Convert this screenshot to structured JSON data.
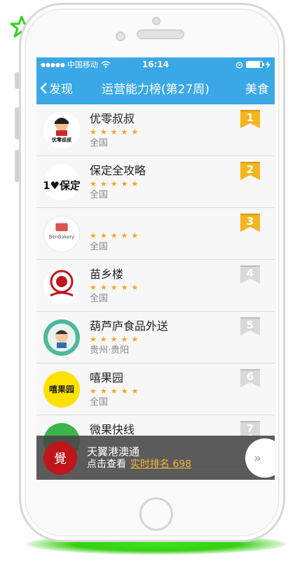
{
  "status": {
    "signal": "●●●●●",
    "carrier": "中国移动",
    "wifi_icon": "wifi-icon",
    "time": "16:14"
  },
  "nav": {
    "back_label": "发现",
    "title": "运营能力榜(第27周)",
    "right_label": "美食"
  },
  "colors": {
    "brand": "#3aa8e6",
    "gold_badge": "#f5b51f",
    "grey_badge": "#d9d9d9",
    "star": "#f5a623"
  },
  "list": [
    {
      "rank": "1",
      "name": "优零叔叔",
      "stars": "★★★★★",
      "region": "全国",
      "logo_text": "优零叔叔",
      "badge": "gold"
    },
    {
      "rank": "2",
      "name": "保定全攻略",
      "stars": "★★★★★",
      "region": "全国",
      "logo_text": "1♥保定",
      "badge": "gold"
    },
    {
      "rank": "3",
      "name": "",
      "stars": "★★★★★",
      "region": "全国",
      "logo_text": "BenBakery",
      "badge": "gold"
    },
    {
      "rank": "4",
      "name": "苗乡楼",
      "stars": "★★★★★",
      "region": "全国",
      "logo_text": "",
      "badge": "grey"
    },
    {
      "rank": "5",
      "name": "葫芦庐食品外送",
      "stars": "★★★★★",
      "region": "贵州·贵阳",
      "logo_text": "",
      "badge": "grey"
    },
    {
      "rank": "6",
      "name": "嘻果园",
      "stars": "★★★★★",
      "region": "全国",
      "logo_text": "嘻果园",
      "badge": "grey"
    },
    {
      "rank": "7",
      "name": "微果快线",
      "stars": "",
      "region": "",
      "logo_text": "",
      "badge": "grey"
    }
  ],
  "bottom": {
    "name": "天翼港澳通",
    "prefix": "点击查看",
    "rank_label": "实时排名 698",
    "logo_text": "覺",
    "arrow": "»"
  }
}
